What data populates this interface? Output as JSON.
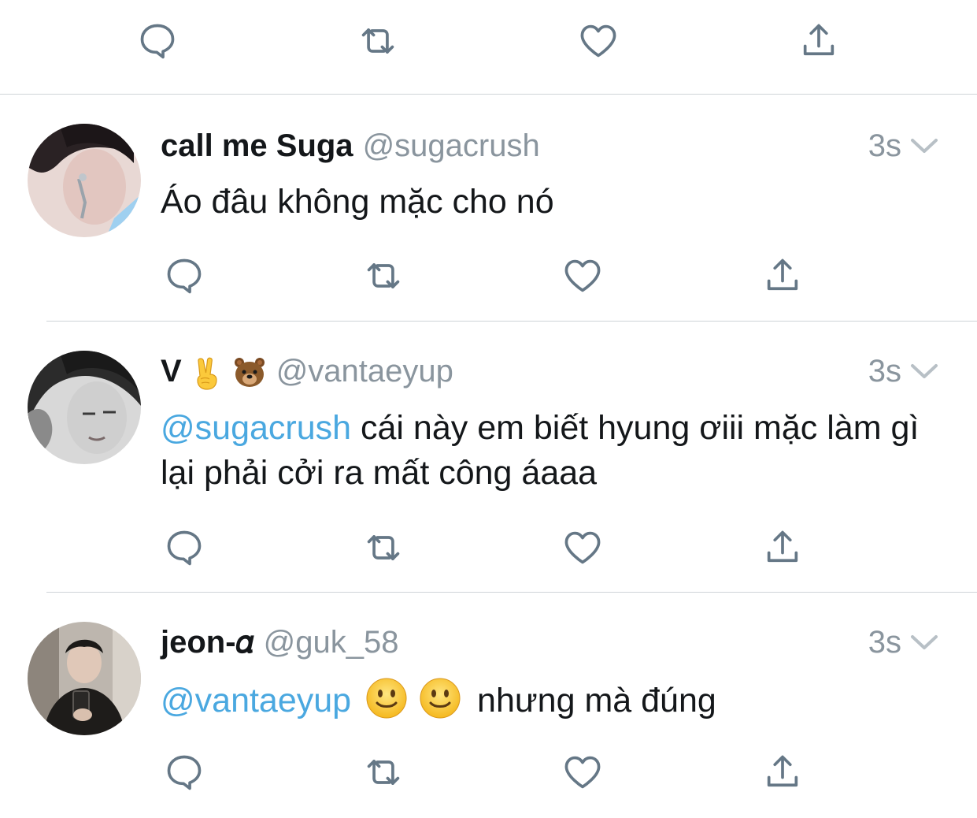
{
  "colors": {
    "icon": "#657786",
    "mention": "#4aa8e0",
    "handle": "#8a959e",
    "divider": "#cfd4d8"
  },
  "actions": {
    "reply_icon": "reply-icon",
    "retweet_icon": "retweet-icon",
    "like_icon": "heart-icon",
    "share_icon": "share-icon"
  },
  "tweets": [
    {
      "name": "call me Suga",
      "handle": "@sugacrush",
      "time": "3s",
      "text": "Áo đâu không mặc cho nó"
    },
    {
      "name": "V",
      "name_emojis": [
        "victory-hand-emoji",
        "bear-emoji"
      ],
      "handle": "@vantaeyup",
      "time": "3s",
      "mention": "@sugacrush",
      "text": "cái này em biết hyung ơiii mặc làm gì lại phải cởi ra mất công áaaa"
    },
    {
      "name": "jeon-𝛼",
      "handle": "@guk_58",
      "time": "3s",
      "mention": "@vantaeyup",
      "text_emojis": [
        "slightly-smiling-face-emoji",
        "slightly-smiling-face-emoji"
      ],
      "text": "nhưng mà đúng"
    }
  ]
}
